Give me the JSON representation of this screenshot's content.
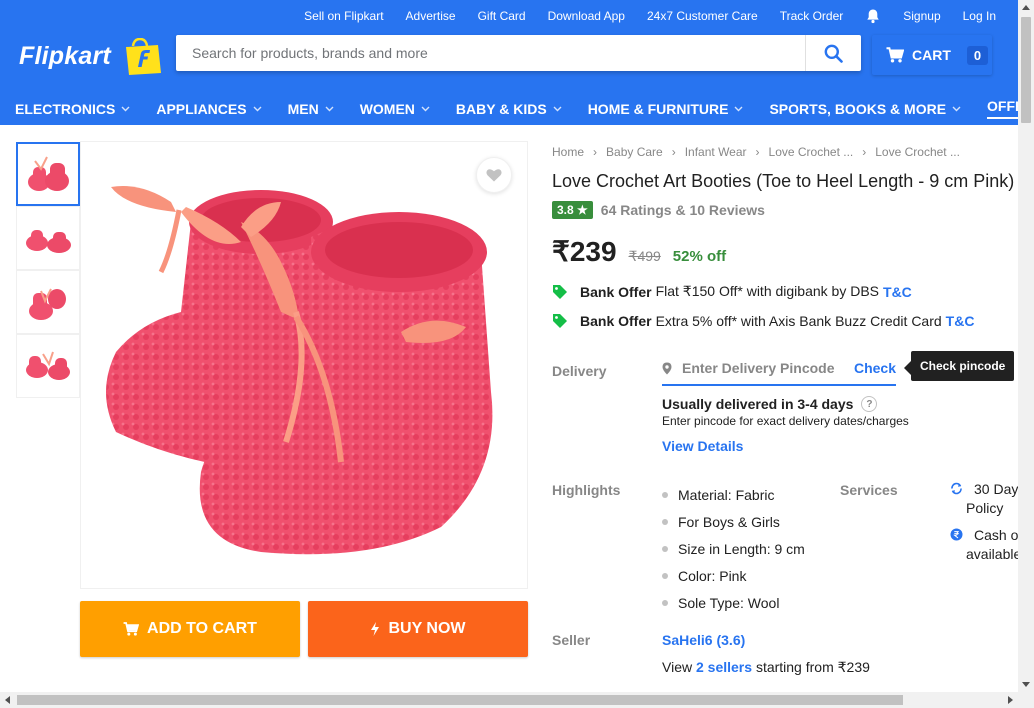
{
  "header": {
    "top_links": [
      "Sell on Flipkart",
      "Advertise",
      "Gift Card",
      "Download App",
      "24x7 Customer Care",
      "Track Order"
    ],
    "signup": "Signup",
    "login": "Log In",
    "logo": "Flipkart",
    "search_placeholder": "Search for products, brands and more",
    "cart_label": "CART",
    "cart_count": "0",
    "colors": {
      "brand_blue": "#2874f0",
      "logo_yellow": "#ffe11b"
    }
  },
  "nav": [
    {
      "label": "ELECTRONICS",
      "chevron": true
    },
    {
      "label": "APPLIANCES",
      "chevron": true
    },
    {
      "label": "MEN",
      "chevron": true
    },
    {
      "label": "WOMEN",
      "chevron": true
    },
    {
      "label": "BABY & KIDS",
      "chevron": true
    },
    {
      "label": "HOME & FURNITURE",
      "chevron": true
    },
    {
      "label": "SPORTS, BOOKS & MORE",
      "chevron": true
    },
    {
      "label": "OFFER ZONE",
      "chevron": false
    }
  ],
  "product": {
    "breadcrumbs": [
      "Home",
      "Baby Care",
      "Infant Wear",
      "Love Crochet ...",
      "Love Crochet ..."
    ],
    "title": "Love Crochet Art Booties  (Toe to Heel Length - 9 cm Pink)",
    "rating": "3.8 ★",
    "rating_text": "64 Ratings & 10 Reviews",
    "price": "₹239",
    "mrp": "₹499",
    "discount": "52% off",
    "offers": [
      {
        "title": "Bank Offer",
        "text": "Flat ₹150 Off* with digibank by DBS",
        "link": "T&C"
      },
      {
        "title": "Bank Offer",
        "text": "Extra 5% off* with Axis Bank Buzz Credit Card",
        "link": "T&C"
      }
    ],
    "add_to_cart": "ADD TO CART",
    "buy_now": "BUY NOW",
    "colors": {
      "add_to_cart": "#ff9f00",
      "buy_now": "#fb641b",
      "rating_green": "#388e3c",
      "booty_pink": "#f0506e"
    }
  },
  "delivery": {
    "label": "Delivery",
    "pincode_placeholder": "Enter Delivery Pincode",
    "check": "Check",
    "tooltip": "Check pincode",
    "usually": "Usually delivered in 3-4 days",
    "help": "?",
    "sub": "Enter pincode for exact delivery dates/charges",
    "view_details": "View Details"
  },
  "highlights": {
    "label": "Highlights",
    "items": [
      "Material: Fabric",
      "For Boys & Girls",
      "Size in Length: 9 cm",
      "Color: Pink",
      "Sole Type: Wool"
    ]
  },
  "services": {
    "label": "Services",
    "items": [
      {
        "icon": "return-icon",
        "line1": "30 Day",
        "line2": "Policy"
      },
      {
        "icon": "rupee-icon",
        "line1": "Cash o",
        "line2": "available"
      }
    ]
  },
  "seller": {
    "label": "Seller",
    "name": "SaHeli6 (3.6)",
    "view": "View",
    "sellers_link": "2 sellers",
    "starting": "starting from ₹239"
  }
}
